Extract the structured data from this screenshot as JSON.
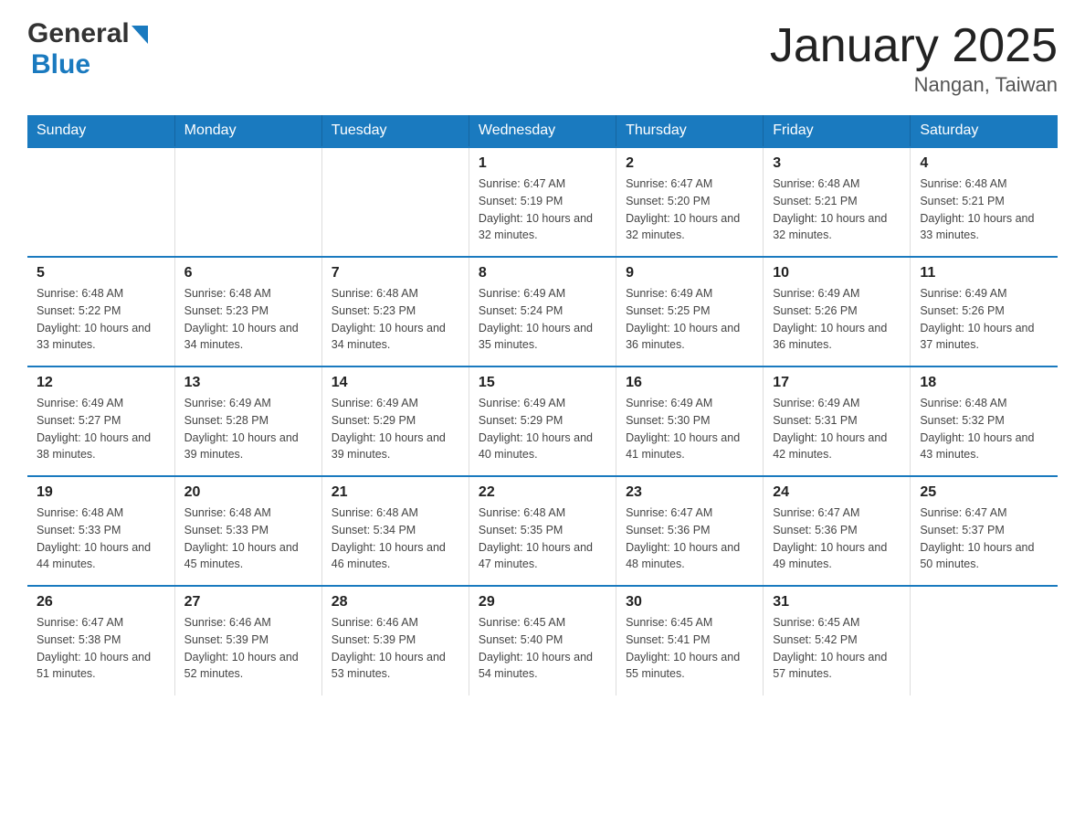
{
  "logo": {
    "general": "General",
    "blue": "Blue",
    "triangle_alt": "triangle"
  },
  "title": "January 2025",
  "subtitle": "Nangan, Taiwan",
  "days_of_week": [
    "Sunday",
    "Monday",
    "Tuesday",
    "Wednesday",
    "Thursday",
    "Friday",
    "Saturday"
  ],
  "weeks": [
    [
      {
        "day": "",
        "info": ""
      },
      {
        "day": "",
        "info": ""
      },
      {
        "day": "",
        "info": ""
      },
      {
        "day": "1",
        "info": "Sunrise: 6:47 AM\nSunset: 5:19 PM\nDaylight: 10 hours and 32 minutes."
      },
      {
        "day": "2",
        "info": "Sunrise: 6:47 AM\nSunset: 5:20 PM\nDaylight: 10 hours and 32 minutes."
      },
      {
        "day": "3",
        "info": "Sunrise: 6:48 AM\nSunset: 5:21 PM\nDaylight: 10 hours and 32 minutes."
      },
      {
        "day": "4",
        "info": "Sunrise: 6:48 AM\nSunset: 5:21 PM\nDaylight: 10 hours and 33 minutes."
      }
    ],
    [
      {
        "day": "5",
        "info": "Sunrise: 6:48 AM\nSunset: 5:22 PM\nDaylight: 10 hours and 33 minutes."
      },
      {
        "day": "6",
        "info": "Sunrise: 6:48 AM\nSunset: 5:23 PM\nDaylight: 10 hours and 34 minutes."
      },
      {
        "day": "7",
        "info": "Sunrise: 6:48 AM\nSunset: 5:23 PM\nDaylight: 10 hours and 34 minutes."
      },
      {
        "day": "8",
        "info": "Sunrise: 6:49 AM\nSunset: 5:24 PM\nDaylight: 10 hours and 35 minutes."
      },
      {
        "day": "9",
        "info": "Sunrise: 6:49 AM\nSunset: 5:25 PM\nDaylight: 10 hours and 36 minutes."
      },
      {
        "day": "10",
        "info": "Sunrise: 6:49 AM\nSunset: 5:26 PM\nDaylight: 10 hours and 36 minutes."
      },
      {
        "day": "11",
        "info": "Sunrise: 6:49 AM\nSunset: 5:26 PM\nDaylight: 10 hours and 37 minutes."
      }
    ],
    [
      {
        "day": "12",
        "info": "Sunrise: 6:49 AM\nSunset: 5:27 PM\nDaylight: 10 hours and 38 minutes."
      },
      {
        "day": "13",
        "info": "Sunrise: 6:49 AM\nSunset: 5:28 PM\nDaylight: 10 hours and 39 minutes."
      },
      {
        "day": "14",
        "info": "Sunrise: 6:49 AM\nSunset: 5:29 PM\nDaylight: 10 hours and 39 minutes."
      },
      {
        "day": "15",
        "info": "Sunrise: 6:49 AM\nSunset: 5:29 PM\nDaylight: 10 hours and 40 minutes."
      },
      {
        "day": "16",
        "info": "Sunrise: 6:49 AM\nSunset: 5:30 PM\nDaylight: 10 hours and 41 minutes."
      },
      {
        "day": "17",
        "info": "Sunrise: 6:49 AM\nSunset: 5:31 PM\nDaylight: 10 hours and 42 minutes."
      },
      {
        "day": "18",
        "info": "Sunrise: 6:48 AM\nSunset: 5:32 PM\nDaylight: 10 hours and 43 minutes."
      }
    ],
    [
      {
        "day": "19",
        "info": "Sunrise: 6:48 AM\nSunset: 5:33 PM\nDaylight: 10 hours and 44 minutes."
      },
      {
        "day": "20",
        "info": "Sunrise: 6:48 AM\nSunset: 5:33 PM\nDaylight: 10 hours and 45 minutes."
      },
      {
        "day": "21",
        "info": "Sunrise: 6:48 AM\nSunset: 5:34 PM\nDaylight: 10 hours and 46 minutes."
      },
      {
        "day": "22",
        "info": "Sunrise: 6:48 AM\nSunset: 5:35 PM\nDaylight: 10 hours and 47 minutes."
      },
      {
        "day": "23",
        "info": "Sunrise: 6:47 AM\nSunset: 5:36 PM\nDaylight: 10 hours and 48 minutes."
      },
      {
        "day": "24",
        "info": "Sunrise: 6:47 AM\nSunset: 5:36 PM\nDaylight: 10 hours and 49 minutes."
      },
      {
        "day": "25",
        "info": "Sunrise: 6:47 AM\nSunset: 5:37 PM\nDaylight: 10 hours and 50 minutes."
      }
    ],
    [
      {
        "day": "26",
        "info": "Sunrise: 6:47 AM\nSunset: 5:38 PM\nDaylight: 10 hours and 51 minutes."
      },
      {
        "day": "27",
        "info": "Sunrise: 6:46 AM\nSunset: 5:39 PM\nDaylight: 10 hours and 52 minutes."
      },
      {
        "day": "28",
        "info": "Sunrise: 6:46 AM\nSunset: 5:39 PM\nDaylight: 10 hours and 53 minutes."
      },
      {
        "day": "29",
        "info": "Sunrise: 6:45 AM\nSunset: 5:40 PM\nDaylight: 10 hours and 54 minutes."
      },
      {
        "day": "30",
        "info": "Sunrise: 6:45 AM\nSunset: 5:41 PM\nDaylight: 10 hours and 55 minutes."
      },
      {
        "day": "31",
        "info": "Sunrise: 6:45 AM\nSunset: 5:42 PM\nDaylight: 10 hours and 57 minutes."
      },
      {
        "day": "",
        "info": ""
      }
    ]
  ]
}
